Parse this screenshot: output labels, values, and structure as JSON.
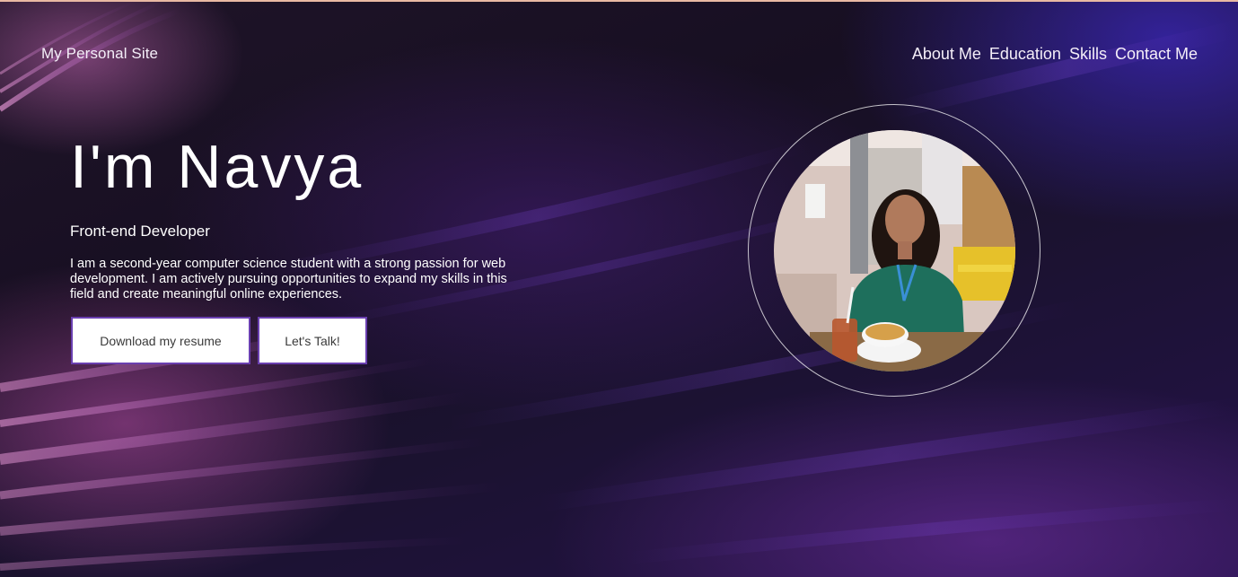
{
  "header": {
    "brand": "My Personal Site",
    "nav": [
      "About Me",
      "Education",
      "Skills",
      "Contact Me"
    ]
  },
  "hero": {
    "heading": "I'm Navya",
    "role": "Front-end Developer",
    "description": "I am a second-year computer science student with a strong passion for web development. I am actively pursuing opportunities to expand my skills in this field and create meaningful online experiences.",
    "buttons": {
      "resume": "Download my resume",
      "talk": "Let's Talk!"
    }
  },
  "icons": {
    "profile_photo": "profile-photo"
  },
  "colors": {
    "background": "#150f1e",
    "button_border": "#6a3fb0",
    "button_bg": "#ffffff",
    "text": "#ffffff"
  }
}
